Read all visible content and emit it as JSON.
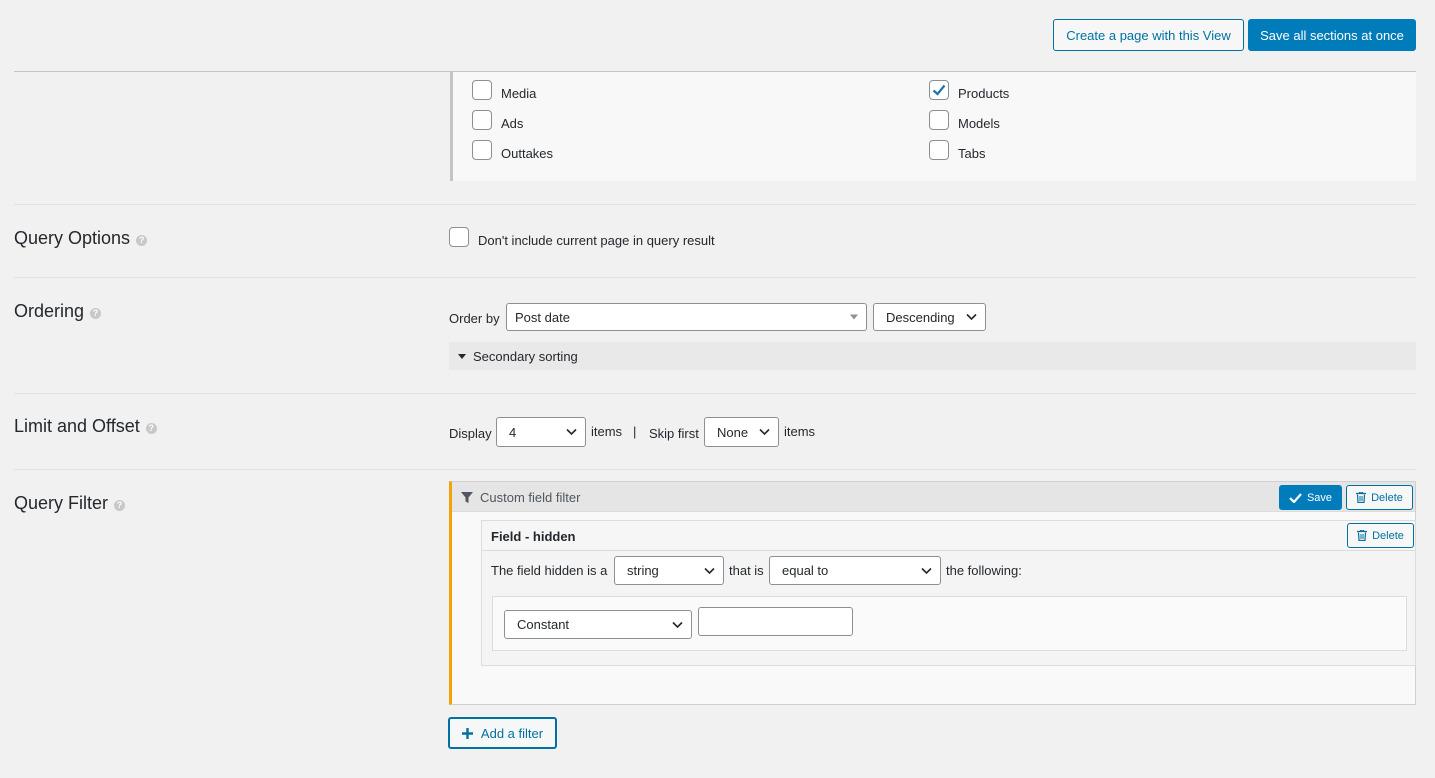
{
  "header": {
    "create_page_label": "Create a page with this View",
    "save_all_label": "Save all sections at once"
  },
  "post_types": {
    "items": [
      {
        "label": "Media",
        "checked": false
      },
      {
        "label": "Ads",
        "checked": false
      },
      {
        "label": "Outtakes",
        "checked": false
      },
      {
        "label": "Products",
        "checked": true
      },
      {
        "label": "Models",
        "checked": false
      },
      {
        "label": "Tabs",
        "checked": false
      }
    ]
  },
  "query_options": {
    "title": "Query Options",
    "exclude_current_label": "Don't include current page in query result",
    "exclude_current_checked": false
  },
  "ordering": {
    "title": "Ordering",
    "order_by_label": "Order by",
    "order_by_value": "Post date",
    "direction_value": "Descending",
    "secondary_sorting_label": "Secondary sorting"
  },
  "limit_offset": {
    "title": "Limit and Offset",
    "display_label": "Display",
    "display_value": "4",
    "items_label": "items",
    "divider": "|",
    "skip_first_label": "Skip first",
    "skip_value": "None",
    "items_label_2": "items"
  },
  "query_filter": {
    "title": "Query Filter",
    "filter_type_label": "Custom field filter",
    "save_label": "Save",
    "delete_label": "Delete",
    "field_title": "Field - hidden",
    "field_delete_label": "Delete",
    "condition_prefix": "The field hidden is a",
    "type_value": "string",
    "that_is_label": "that is",
    "comparison_value": "equal to",
    "following_label": "the following:",
    "value_source": "Constant",
    "value_input": "",
    "add_filter_label": "Add a filter"
  },
  "colors": {
    "primary": "#007cba",
    "accent_border": "#f0a30a",
    "background": "#f1f1f1"
  }
}
